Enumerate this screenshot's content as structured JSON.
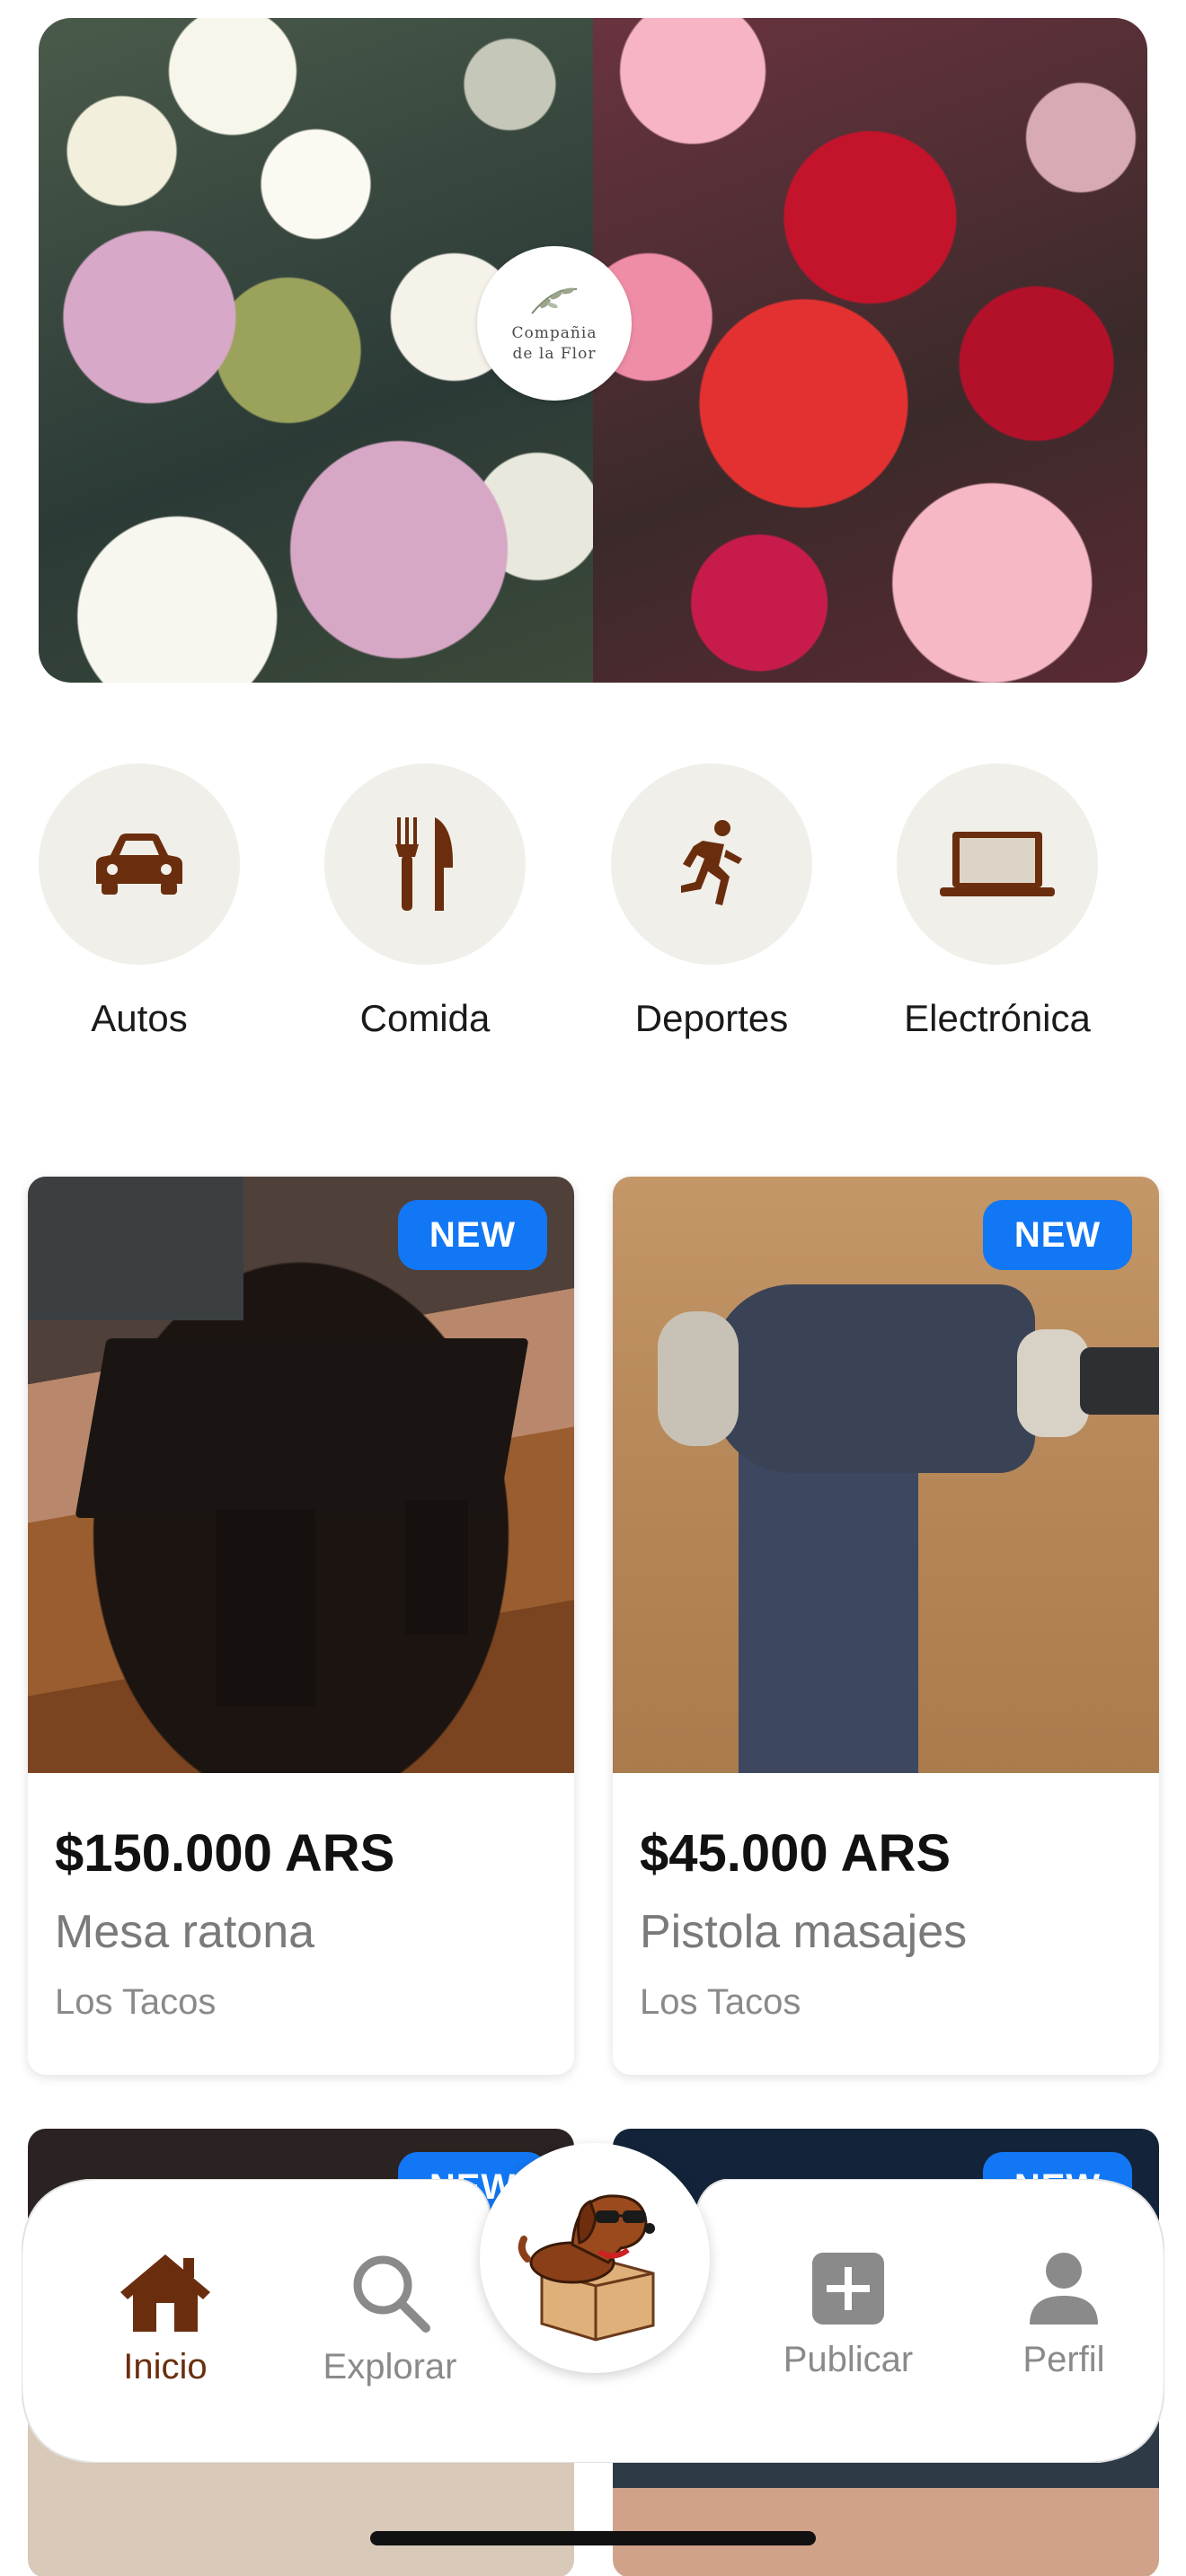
{
  "banner": {
    "logo_line1": "Compañia",
    "logo_line2": "de la Flor"
  },
  "categories": [
    {
      "label": "Autos",
      "icon": "car-icon"
    },
    {
      "label": "Comida",
      "icon": "fork-knife-icon"
    },
    {
      "label": "Deportes",
      "icon": "running-icon"
    },
    {
      "label": "Electrónica",
      "icon": "laptop-icon"
    }
  ],
  "products": [
    {
      "badge": "NEW",
      "price": "$150.000 ARS",
      "title": "Mesa ratona",
      "location": "Los Tacos"
    },
    {
      "badge": "NEW",
      "price": "$45.000 ARS",
      "title": "Pistola masajes",
      "location": "Los Tacos"
    }
  ],
  "products_row2": [
    {
      "badge": "NEW"
    },
    {
      "badge": "NEW"
    }
  ],
  "nav": {
    "items": [
      {
        "label": "Inicio",
        "icon": "home-icon",
        "active": true
      },
      {
        "label": "Explorar",
        "icon": "search-icon"
      },
      {
        "label": "Publicar",
        "icon": "plus-square-icon"
      },
      {
        "label": "Perfil",
        "icon": "person-icon"
      }
    ],
    "center_icon": "dog-mascot-icon"
  },
  "colors": {
    "accent_brown": "#6a2e0e",
    "badge_blue": "#1277f4",
    "category_bg": "#f1efe9"
  }
}
